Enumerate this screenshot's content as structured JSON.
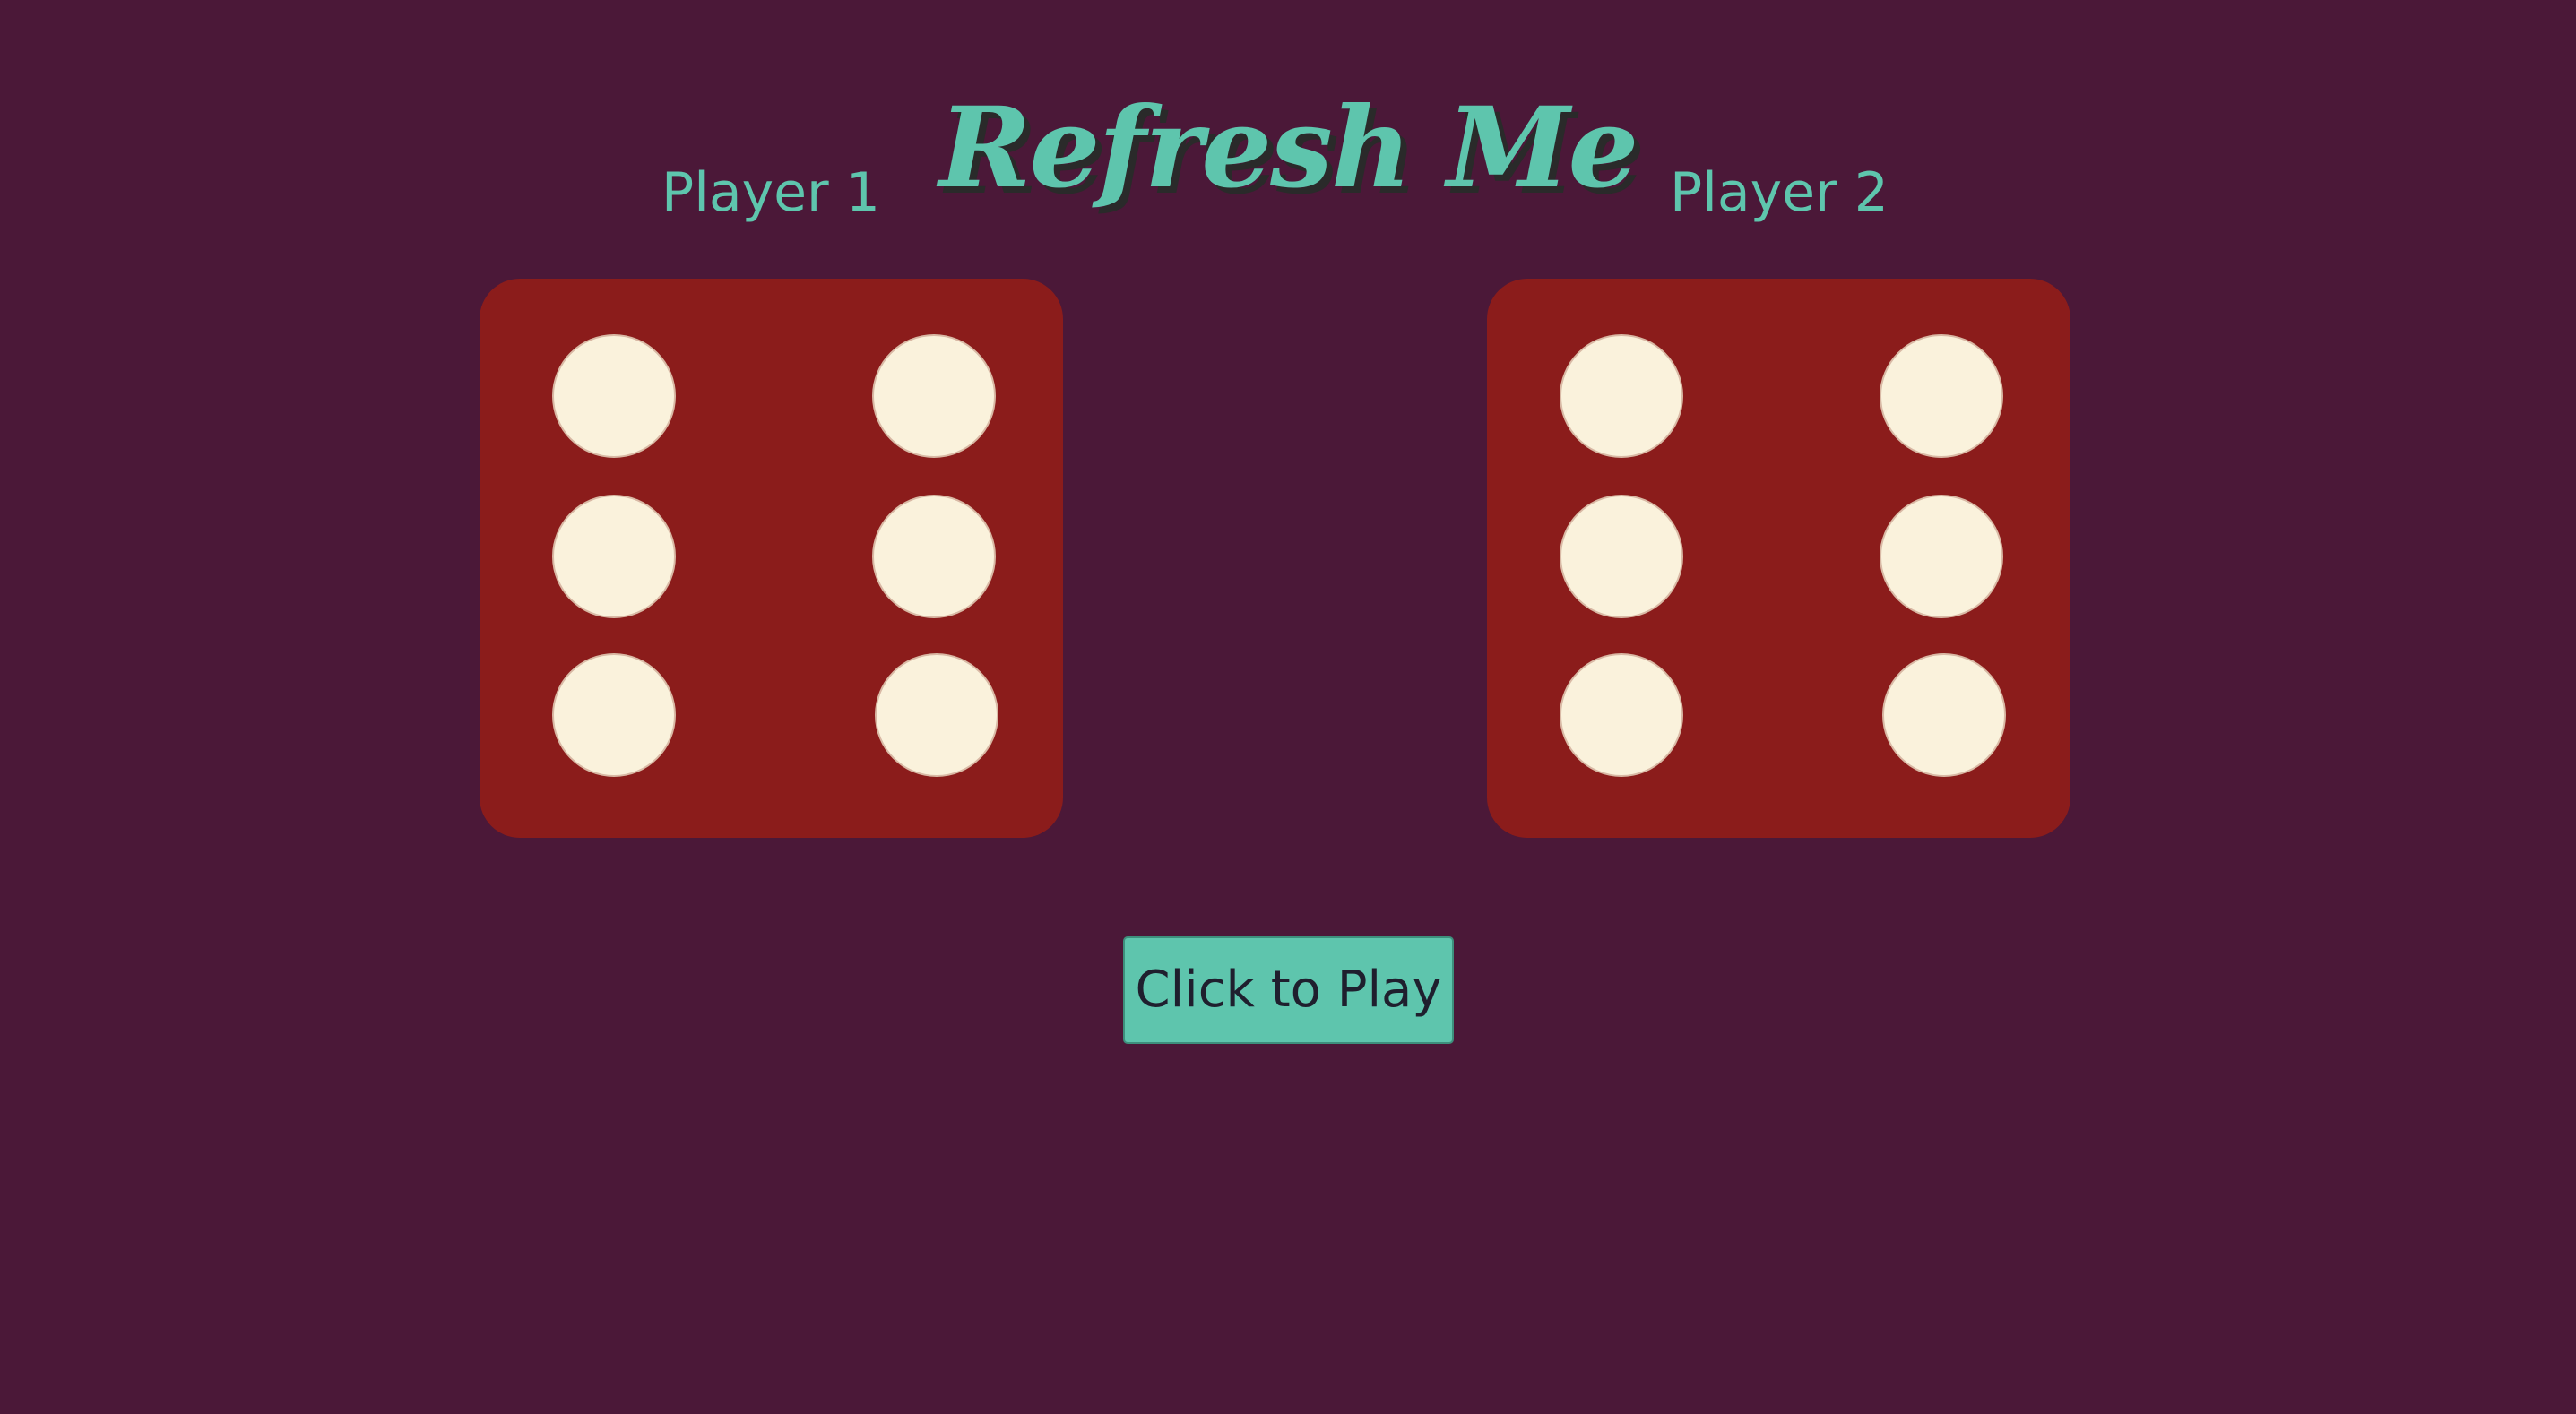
{
  "title": "Refresh Me",
  "players": [
    {
      "label": "Player 1",
      "die_value": 6
    },
    {
      "label": "Player 2",
      "die_value": 6
    }
  ],
  "play_button": {
    "label": "Click to Play"
  },
  "colors": {
    "background": "#4b1838",
    "accent": "#5ec5ad",
    "die": "#8b1c1b",
    "pip": "#faf2dc"
  }
}
